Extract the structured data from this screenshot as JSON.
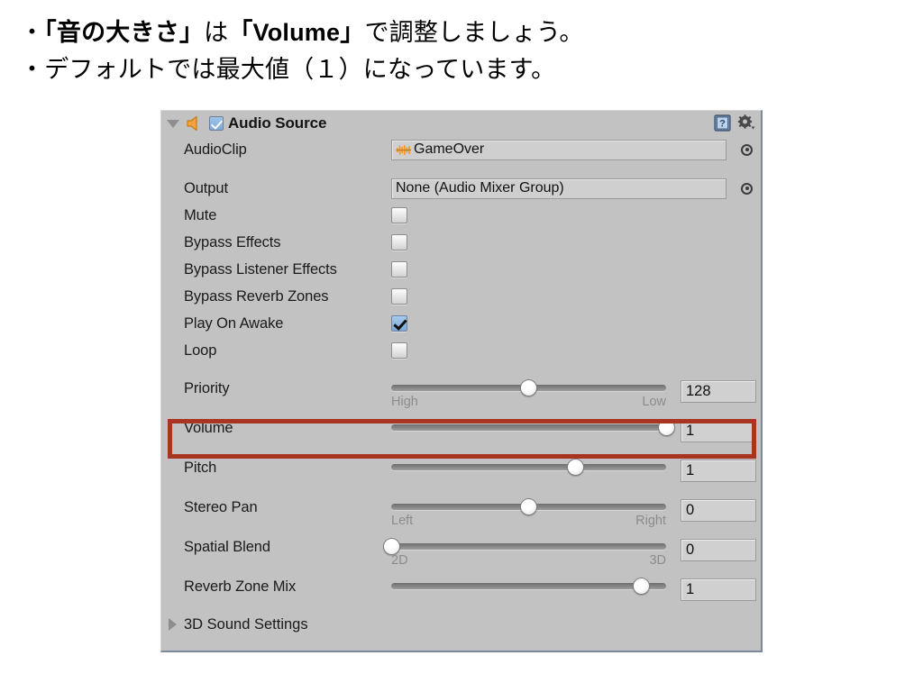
{
  "caption": {
    "line1_parts": [
      {
        "text": "・",
        "bold": false
      },
      {
        "text": "「音の大きさ」",
        "bold": true
      },
      {
        "text": "は",
        "bold": false
      },
      {
        "text": "「Volume」",
        "bold": true
      },
      {
        "text": "で調整しましょう。",
        "bold": false
      }
    ],
    "line2": "・デフォルトでは最大値（１）になっています。"
  },
  "inspector": {
    "component": {
      "title": "Audio Source",
      "enabled_checkbox": true,
      "foldout_expanded": true,
      "icons": {
        "component": "speaker-icon",
        "help": "help-book-icon",
        "settings": "gear-icon"
      }
    },
    "object_fields": [
      {
        "label": "AudioClip",
        "value": "GameOver",
        "has_asset_icon": true,
        "icon": "audio-waveform-icon"
      },
      {
        "label": "Output",
        "value": "None (Audio Mixer Group)",
        "has_asset_icon": false,
        "icon": ""
      }
    ],
    "toggles": [
      {
        "label": "Mute",
        "checked": false
      },
      {
        "label": "Bypass Effects",
        "checked": false
      },
      {
        "label": "Bypass Listener Effects",
        "checked": false
      },
      {
        "label": "Bypass Reverb Zones",
        "checked": false
      },
      {
        "label": "Play On Awake",
        "checked": true
      },
      {
        "label": "Loop",
        "checked": false
      }
    ],
    "sliders": [
      {
        "label": "Priority",
        "value": "128",
        "percent": 50,
        "left_label": "High",
        "right_label": "Low",
        "highlighted": false
      },
      {
        "label": "Volume",
        "value": "1",
        "percent": 100,
        "left_label": "",
        "right_label": "",
        "highlighted": true
      },
      {
        "label": "Pitch",
        "value": "1",
        "percent": 67,
        "left_label": "",
        "right_label": "",
        "highlighted": false
      },
      {
        "label": "Stereo Pan",
        "value": "0",
        "percent": 50,
        "left_label": "Left",
        "right_label": "Right",
        "highlighted": false
      },
      {
        "label": "Spatial Blend",
        "value": "0",
        "percent": 0,
        "left_label": "2D",
        "right_label": "3D",
        "highlighted": false
      },
      {
        "label": "Reverb Zone Mix",
        "value": "1",
        "percent": 91,
        "left_label": "",
        "right_label": "",
        "highlighted": false
      }
    ],
    "footer": {
      "label": "3D Sound Settings",
      "expanded": false
    }
  },
  "colors": {
    "panel_bg": "#c2c2c2",
    "highlight_red": "#a93520",
    "accent_blue": "#7ea8d6",
    "asset_orange": "#f0a030"
  }
}
